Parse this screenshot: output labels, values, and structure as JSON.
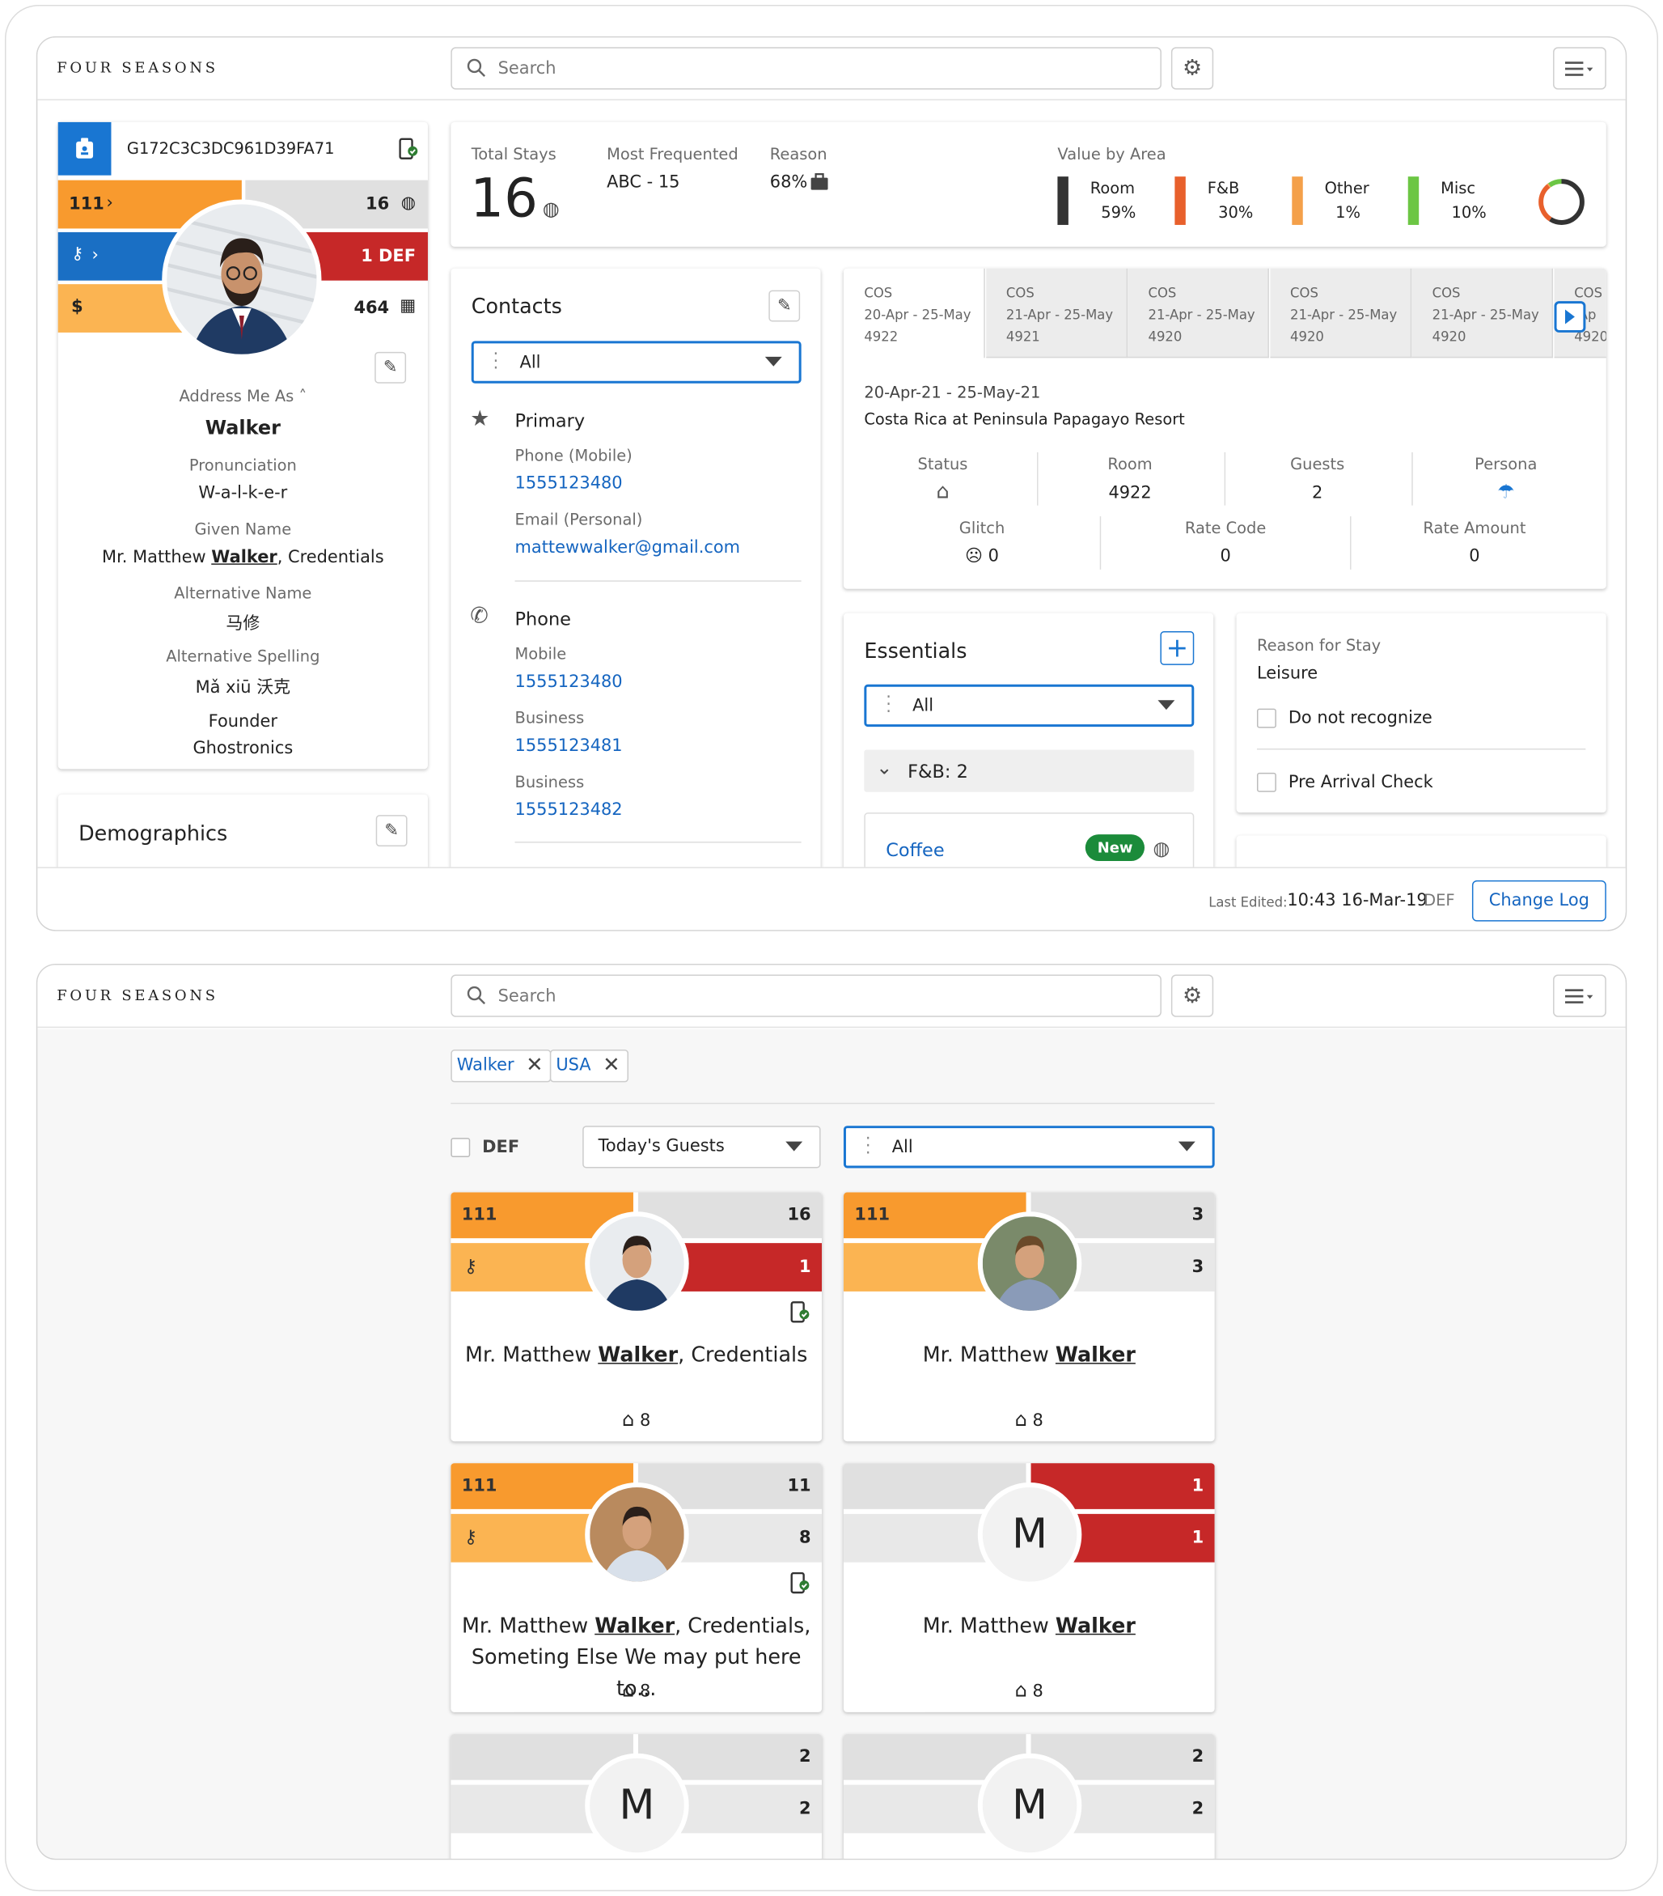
{
  "brand": "FOUR SEASONS",
  "search_placeholder": "Search",
  "profile": {
    "id": "G172C3C3DC961D39FA71",
    "level": "111",
    "stays_count": "16",
    "def": "1 DEF",
    "spend": "464",
    "currency": "$",
    "address_label": "Address Me As",
    "address_value": "Walker",
    "pronunciation_label": "Pronunciation",
    "pronunciation_value": "W-a-l-k-e-r",
    "given_label": "Given Name",
    "given_prefix": "Mr. Matthew ",
    "given_last": "Walker",
    "given_suffix": ", Credentials",
    "alt_name_label": "Alternative Name",
    "alt_name_value": "马修",
    "alt_spell_label": "Alternative Spelling",
    "alt_spell_value": "Mǎ xiū 沃克",
    "title": "Founder",
    "company": "Ghostronics"
  },
  "demographics_title": "Demographics",
  "stats": {
    "total_stays_label": "Total Stays",
    "total_stays_value": "16",
    "most_freq_label": "Most Frequented",
    "most_freq_value": "ABC - 15",
    "reason_label": "Reason",
    "reason_value": "68%",
    "value_by_area_label": "Value by Area",
    "areas": [
      {
        "name": "Room",
        "pct": "59%",
        "color": "#333333"
      },
      {
        "name": "F&B",
        "pct": "30%",
        "color": "#e8602c"
      },
      {
        "name": "Other",
        "pct": "1%",
        "color": "#f4a04a"
      },
      {
        "name": "Misc",
        "pct": "10%",
        "color": "#6cc644"
      }
    ]
  },
  "contacts": {
    "title": "Contacts",
    "filter": "All",
    "primary_label": "Primary",
    "phone_mobile_label": "Phone (Mobile)",
    "phone_mobile": "1555123480",
    "email_label": "Email (Personal)",
    "email": "mattewwalker@gmail.com",
    "phone_label": "Phone",
    "mobile_label": "Mobile",
    "mobile": "1555123480",
    "business_label": "Business",
    "business1": "1555123481",
    "business2_label": "Business",
    "business2": "1555123482"
  },
  "stays_tabs": [
    {
      "code": "COS",
      "dates": "20-Apr - 25-May",
      "room": "4922"
    },
    {
      "code": "COS",
      "dates": "21-Apr - 25-May",
      "room": "4921"
    },
    {
      "code": "COS",
      "dates": "21-Apr - 25-May",
      "room": "4920"
    },
    {
      "code": "COS",
      "dates": "21-Apr - 25-May",
      "room": "4920"
    },
    {
      "code": "COS",
      "dates": "21-Apr - 25-May",
      "room": "4920"
    },
    {
      "code": "COS",
      "dates": "-Ap",
      "room": "4920"
    }
  ],
  "stay_detail": {
    "range": "20-Apr-21  -  25-May-21",
    "property": "Costa Rica at Peninsula Papagayo Resort",
    "status_label": "Status",
    "room_label": "Room",
    "room": "4922",
    "guests_label": "Guests",
    "guests": "2",
    "persona_label": "Persona",
    "glitch_label": "Glitch",
    "glitch": "0",
    "rate_code_label": "Rate Code",
    "rate_code": "0",
    "rate_amount_label": "Rate Amount",
    "rate_amount": "0"
  },
  "essentials": {
    "title": "Essentials",
    "filter": "All",
    "group": "F&B: 2",
    "item": "Coffee",
    "badge": "New"
  },
  "reason": {
    "label": "Reason for Stay",
    "value": "Leisure",
    "check1": "Do not recognize",
    "check2": "Pre Arrival Check"
  },
  "footer": {
    "last_edited_label": "Last Edited:",
    "last_edited": "10:43 16-Mar-19",
    "last_edited_user": "DEF",
    "change_log": "Change Log"
  },
  "search2": {
    "chips": [
      "Walker",
      "USA"
    ],
    "def_label": "DEF",
    "list_filter": "Today's Guests",
    "type_filter": "All"
  },
  "guests": [
    {
      "level": "111",
      "top_right": "16",
      "bottom_right": "1",
      "prefix": "Mr. Matthew ",
      "last": "Walker",
      "suffix": ", Credentials",
      "line2": "",
      "stays": "8",
      "avatar": "",
      "scheme": "a"
    },
    {
      "level": "111",
      "top_right": "3",
      "bottom_right": "3",
      "prefix": "Mr. Matthew ",
      "last": "Walker",
      "suffix": "",
      "line2": "",
      "stays": "8",
      "avatar": "",
      "scheme": "b"
    },
    {
      "level": "111",
      "top_right": "11",
      "bottom_right": "8",
      "prefix": "Mr. Matthew ",
      "last": "Walker",
      "suffix": ", Credentials,",
      "line2": "Someting Else We may put here to...",
      "stays": "8",
      "avatar": "",
      "scheme": "c"
    },
    {
      "level": "",
      "top_right": "1",
      "bottom_right": "1",
      "prefix": "Mr. Matthew ",
      "last": "Walker",
      "suffix": "",
      "line2": "",
      "stays": "8",
      "avatar": "M",
      "scheme": "d"
    },
    {
      "level": "",
      "top_right": "2",
      "bottom_right": "2",
      "prefix": "",
      "last": "",
      "suffix": "",
      "line2": "",
      "stays": "",
      "avatar": "M",
      "scheme": "e"
    },
    {
      "level": "",
      "top_right": "2",
      "bottom_right": "2",
      "prefix": "",
      "last": "",
      "suffix": "",
      "line2": "",
      "stays": "",
      "avatar": "M",
      "scheme": "e"
    }
  ]
}
